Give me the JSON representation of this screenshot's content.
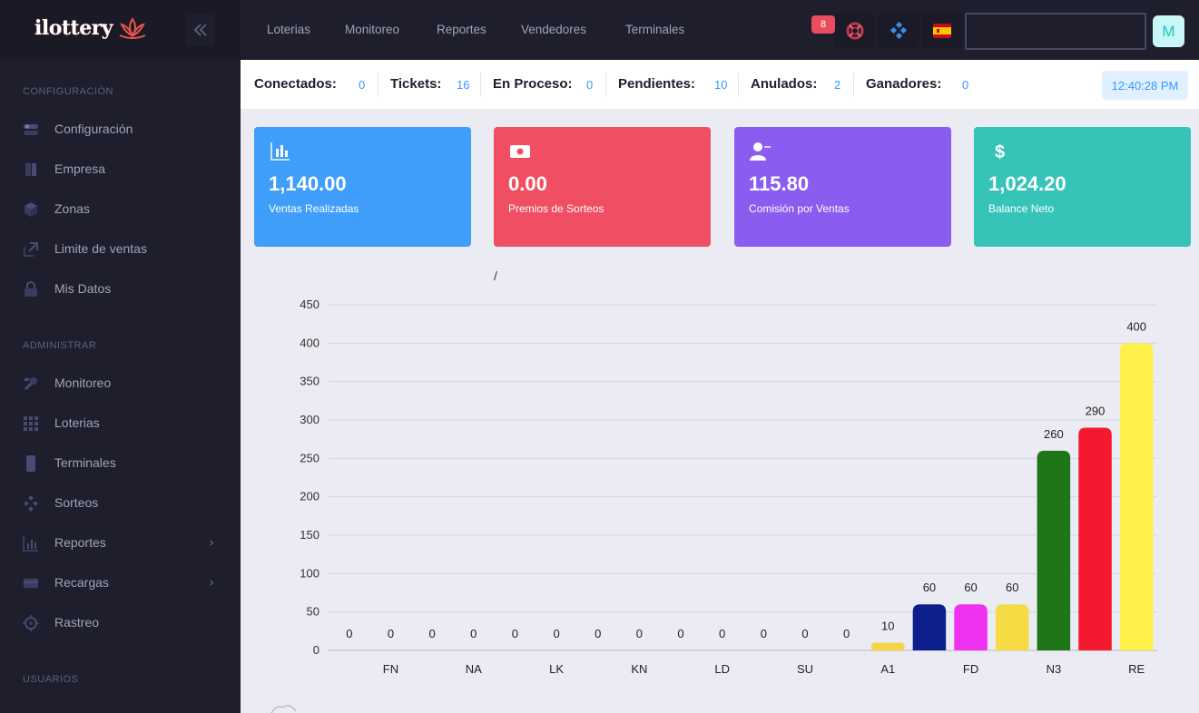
{
  "brand": {
    "logo_text": "ilottery"
  },
  "topbar": {
    "menu": [
      "Loterias",
      "Monitoreo",
      "Reportes",
      "Vendedores",
      "Terminales"
    ],
    "notification_count": "8",
    "avatar_letter": "M",
    "search_value": ""
  },
  "sidebar": {
    "sections": [
      {
        "title": "CONFIGURACIÓN",
        "items": [
          {
            "label": "Configuración",
            "icon": "toggle-icon"
          },
          {
            "label": "Empresa",
            "icon": "building-icon"
          },
          {
            "label": "Zonas",
            "icon": "cube-icon"
          },
          {
            "label": "Limite de ventas",
            "icon": "expand-icon"
          },
          {
            "label": "Mis Datos",
            "icon": "lock-icon"
          }
        ]
      },
      {
        "title": "ADMINISTRAR",
        "items": [
          {
            "label": "Monitoreo",
            "icon": "tools-icon"
          },
          {
            "label": "Loterias",
            "icon": "grid-icon"
          },
          {
            "label": "Terminales",
            "icon": "phone-icon"
          },
          {
            "label": "Sorteos",
            "icon": "diamond-icon"
          },
          {
            "label": "Reportes",
            "icon": "chart-icon",
            "has_submenu": true
          },
          {
            "label": "Recargas",
            "icon": "card-icon",
            "has_submenu": true
          },
          {
            "label": "Rastreo",
            "icon": "target-icon"
          }
        ]
      },
      {
        "title": "USUARIOS",
        "items": []
      }
    ]
  },
  "status": {
    "items": [
      {
        "label": "Conectados:",
        "value": "0"
      },
      {
        "label": "Tickets:",
        "value": "16"
      },
      {
        "label": "En Proceso:",
        "value": "0"
      },
      {
        "label": "Pendientes:",
        "value": "10"
      },
      {
        "label": "Anulados:",
        "value": "2"
      },
      {
        "label": "Ganadores:",
        "value": "0"
      }
    ],
    "time": "12:40:28 PM"
  },
  "cards": [
    {
      "value": "1,140.00",
      "label": "Ventas Realizadas",
      "color": "#3f9ef9",
      "icon": "bar-chart-icon"
    },
    {
      "value": "0.00",
      "label": "Premios de Sorteos",
      "color": "#f04f63",
      "icon": "money-icon"
    },
    {
      "value": "115.80",
      "label": "Comisión por Ventas",
      "color": "#8b5cf0",
      "icon": "user-minus-icon"
    },
    {
      "value": "1,024.20",
      "label": "Balance Neto",
      "color": "#36c4b9",
      "icon": "dollar-icon"
    }
  ],
  "chart_data": {
    "type": "bar",
    "title": "/",
    "categories": [
      "",
      "FN",
      "",
      "NA",
      "",
      "LK",
      "",
      "KN",
      "",
      "LD",
      "",
      "SU",
      "",
      "A1",
      "",
      "FD",
      "",
      "N3",
      "",
      "RE"
    ],
    "values": [
      0,
      0,
      0,
      0,
      0,
      0,
      0,
      0,
      0,
      0,
      0,
      0,
      0,
      10,
      60,
      60,
      60,
      260,
      290,
      400
    ],
    "bar_colors": [
      "#888",
      "#888",
      "#888",
      "#888",
      "#888",
      "#888",
      "#888",
      "#888",
      "#888",
      "#888",
      "#888",
      "#888",
      "#888",
      "#f5d547",
      "#0d1f8c",
      "#ee32ef",
      "#f5dc44",
      "#1e7618",
      "#f51930",
      "#fff04a"
    ],
    "ylim": [
      0,
      450
    ],
    "yticks": [
      0,
      50,
      100,
      150,
      200,
      250,
      300,
      350,
      400,
      450
    ],
    "xlabel": "",
    "ylabel": "",
    "grid": true
  }
}
